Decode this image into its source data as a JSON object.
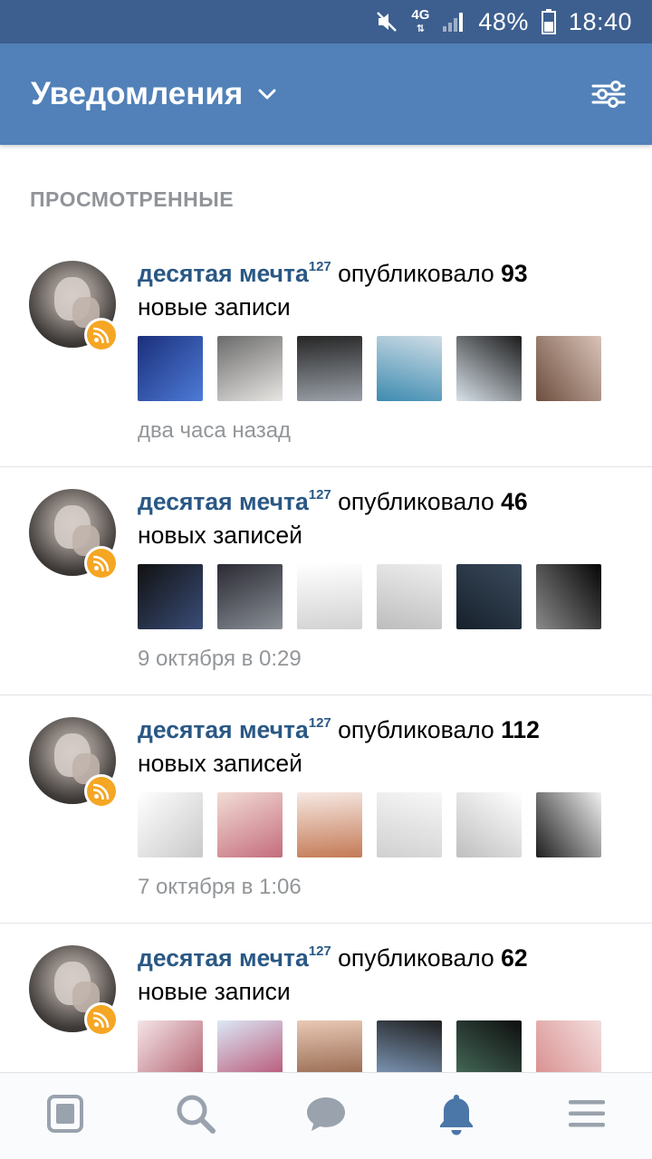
{
  "status_bar": {
    "battery": "48%",
    "time": "18:40",
    "network": "4G"
  },
  "header": {
    "title": "Уведомления"
  },
  "section_label": "ПРОСМОТРЕННЫЕ",
  "notifications": [
    {
      "author": "десятая мечта",
      "author_sup": "127",
      "action": "опубликовало",
      "count": "93",
      "suffix": "новые записи",
      "time": "два часа назад",
      "thumb_colors": [
        [
          "#1b2f7a",
          "#4d7bd8"
        ],
        [
          "#6b6b6b",
          "#e8e6e3"
        ],
        [
          "#262626",
          "#9aa0a8"
        ],
        [
          "#cfdde6",
          "#3d8bb0"
        ],
        [
          "#1b1b1b",
          "#d9e2ea"
        ],
        [
          "#d9c3b8",
          "#6d4e3e"
        ]
      ]
    },
    {
      "author": "десятая мечта",
      "author_sup": "127",
      "action": "опубликовало",
      "count": "46",
      "suffix": "новых записей",
      "time": "9 октября в 0:29",
      "thumb_colors": [
        [
          "#111111",
          "#3a4d78"
        ],
        [
          "#2a2a33",
          "#8a8f96"
        ],
        [
          "#ffffff",
          "#d2d2d2"
        ],
        [
          "#eeeeee",
          "#bdbdbd"
        ],
        [
          "#3a4a5c",
          "#16202b"
        ],
        [
          "#050505",
          "#8a8a8a"
        ]
      ]
    },
    {
      "author": "десятая мечта",
      "author_sup": "127",
      "action": "опубликовало",
      "count": "112",
      "suffix": "новых записей",
      "time": "7 октября в 1:06",
      "thumb_colors": [
        [
          "#ffffff",
          "#c9c9c9"
        ],
        [
          "#f2dcd6",
          "#c46d7b"
        ],
        [
          "#f6e8e3",
          "#c47a55"
        ],
        [
          "#f7f7f7",
          "#d0d0d0"
        ],
        [
          "#ffffff",
          "#bfbfbf"
        ],
        [
          "#f1f1f1",
          "#1e1e1e"
        ]
      ]
    },
    {
      "author": "десятая мечта",
      "author_sup": "127",
      "action": "опубликовало",
      "count": "62",
      "suffix": "новые записи",
      "time": "",
      "thumb_colors": [
        [
          "#f4e5e8",
          "#b05a6a"
        ],
        [
          "#dbe8f6",
          "#b5486a"
        ],
        [
          "#e9c9b5",
          "#8a5a40"
        ],
        [
          "#202020",
          "#8aa8cc"
        ],
        [
          "#0e0e0e",
          "#4a7260"
        ],
        [
          "#f3dede",
          "#d88b8b"
        ]
      ]
    }
  ],
  "bottom_nav": [
    {
      "name": "news-icon",
      "active": false
    },
    {
      "name": "search-icon",
      "active": false
    },
    {
      "name": "messages-icon",
      "active": false
    },
    {
      "name": "notifications-bell-icon",
      "active": true
    },
    {
      "name": "menu-icon",
      "active": false
    }
  ],
  "colors": {
    "accent": "#5181b8",
    "author": "#2a5885",
    "muted": "#939699",
    "nav_inactive": "#99a2ad",
    "nav_active": "#4a76a8",
    "rss": "#f5a623"
  }
}
